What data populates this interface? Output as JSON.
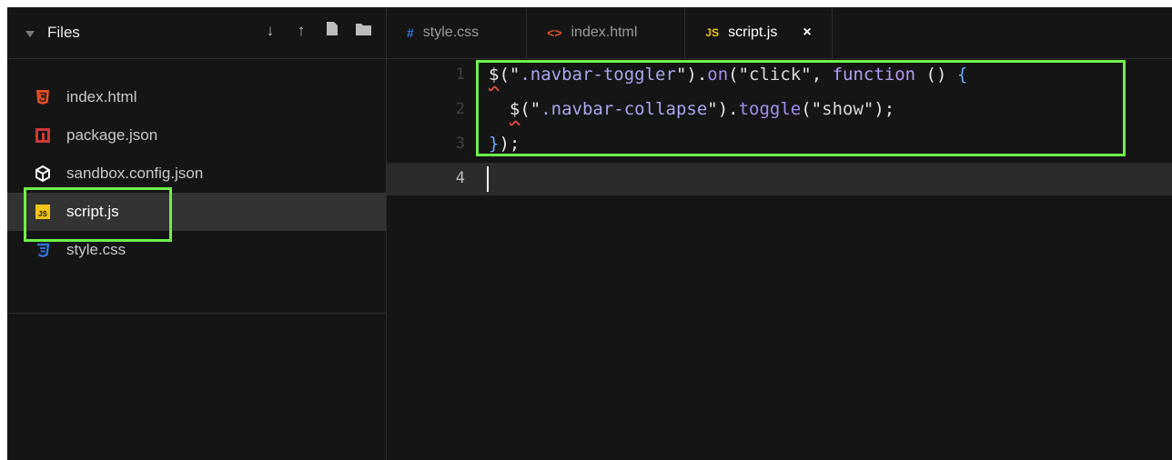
{
  "sidebar": {
    "title": "Files",
    "actions": [
      "↓",
      "↑",
      "new-file",
      "new-folder"
    ],
    "files": [
      {
        "label": "index.html",
        "icon": "html5-icon",
        "color": "#e44d26"
      },
      {
        "label": "package.json",
        "icon": "npm-icon",
        "color": "#cb3837"
      },
      {
        "label": "sandbox.config.json",
        "icon": "cube-icon",
        "color": "#ffffff"
      },
      {
        "label": "script.js",
        "icon": "javascript-icon",
        "color": "#f0c419",
        "active": true
      },
      {
        "label": "style.css",
        "icon": "css3-icon",
        "color": "#2f72d8"
      }
    ]
  },
  "tabs": [
    {
      "label": "style.css",
      "icon_text": "#",
      "icon_color": "#2f72d8"
    },
    {
      "label": "index.html",
      "icon_text": "<>",
      "icon_color": "#e44d26"
    },
    {
      "label": "script.js",
      "icon_text": "JS",
      "icon_color": "#f0c419",
      "active": true,
      "close": "×"
    }
  ],
  "editor": {
    "line_numbers": [
      "1",
      "2",
      "3",
      "4"
    ],
    "lines": [
      "$(\".navbar-toggler\").on(\"click\", function () {",
      "  $(\".navbar-collapse\").toggle(\"show\");",
      "});",
      ""
    ]
  },
  "colors": {
    "highlight": "#6ef04a",
    "background": "#151515"
  }
}
